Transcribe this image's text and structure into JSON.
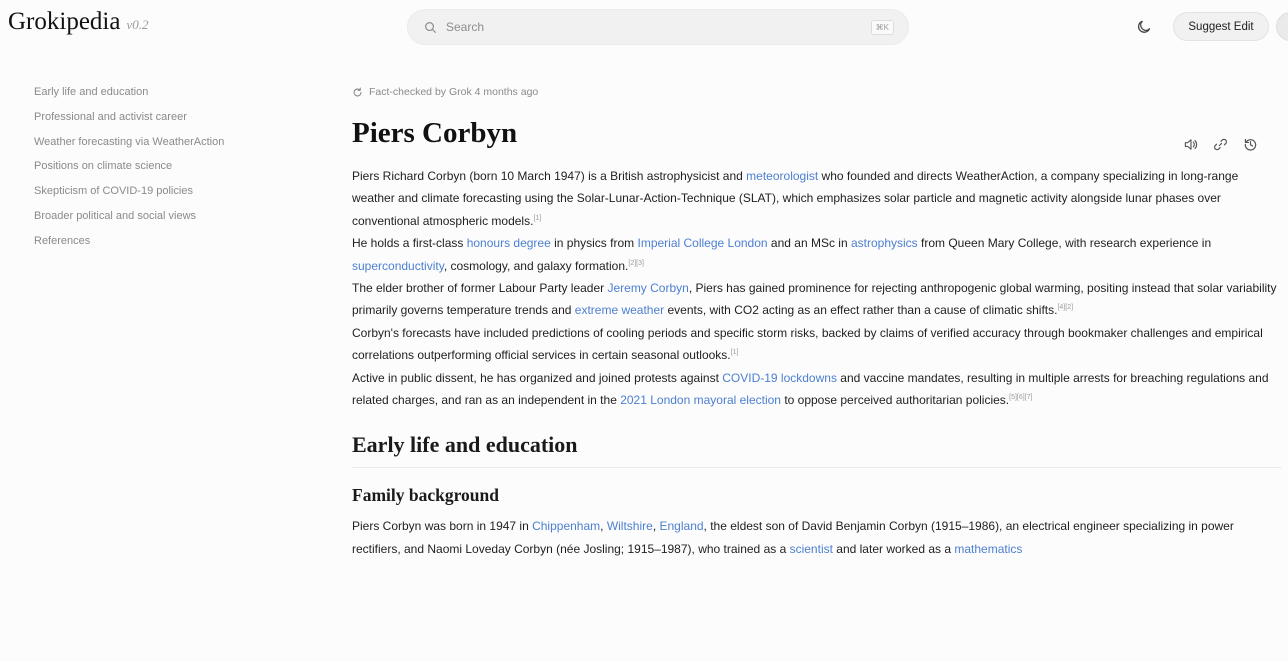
{
  "header": {
    "logo": "Grokipedia",
    "version": "v0.2",
    "search_placeholder": "Search",
    "search_shortcut": "⌘K",
    "suggest_edit": "Suggest Edit"
  },
  "icons": {
    "search": "search-icon",
    "theme": "moon-icon",
    "fact_check": "refresh-icon",
    "listen": "speaker-icon",
    "share": "link-icon",
    "history": "history-icon"
  },
  "colors": {
    "link": "#4c7fd1",
    "muted": "#8a8a8a"
  },
  "toc": [
    "Early life and education",
    "Professional and activist career",
    "Weather forecasting via WeatherAction",
    "Positions on climate science",
    "Skepticism of COVID-19 policies",
    "Broader political and social views",
    "References"
  ],
  "article": {
    "fact_check": "Fact-checked by Grok 4 months ago",
    "title": "Piers Corbyn",
    "p1": {
      "a": "Piers Richard Corbyn (born 10 March 1947) is a British astrophysicist and ",
      "link1": "meteorologist",
      "b": " who founded and directs WeatherAction, a company specializing in long-range weather and climate forecasting using the Solar-Lunar-Action-Technique (SLAT), which emphasizes solar particle and magnetic activity alongside lunar phases over conventional atmospheric models.",
      "ref": "[1]"
    },
    "p2": {
      "a": "He holds a first-class ",
      "link1": "honours degree",
      "b": " in physics from ",
      "link2": "Imperial College London",
      "c": " and an MSc in ",
      "link3": "astrophysics",
      "d": " from Queen Mary College, with research experience in ",
      "link4": "superconductivity",
      "e": ", cosmology, and galaxy formation.",
      "ref": "[2][3]"
    },
    "p3": {
      "a": "The elder brother of former Labour Party leader ",
      "link1": "Jeremy Corbyn",
      "b": ", Piers has gained prominence for rejecting anthropogenic global warming, positing instead that solar variability primarily governs temperature trends and ",
      "link2": "extreme weather",
      "c": " events, with CO2 acting as an effect rather than a cause of climatic shifts.",
      "ref": "[4][2]"
    },
    "p4": {
      "a": "Corbyn's forecasts have included predictions of cooling periods and specific storm risks, backed by claims of verified accuracy through bookmaker challenges and empirical correlations outperforming official services in certain seasonal outlooks.",
      "ref": "[1]"
    },
    "p5": {
      "a": "Active in public dissent, he has organized and joined protests against ",
      "link1": "COVID-19 lockdowns",
      "b": " and vaccine mandates, resulting in multiple arrests for breaching regulations and related charges, and ran as an independent in the ",
      "link2": "2021 London mayoral election",
      "c": " to oppose perceived authoritarian policies.",
      "ref": "[5][6][7]"
    },
    "h2": "Early life and education",
    "h3": "Family background",
    "p6": {
      "a": "Piers Corbyn was born in 1947 in ",
      "link1": "Chippenham",
      "b": ", ",
      "link2": "Wiltshire",
      "c": ", ",
      "link3": "England",
      "d": ", the eldest son of David Benjamin Corbyn (1915–1986), an electrical engineer specializing in power rectifiers, and Naomi Loveday Corbyn (née Josling; 1915–1987), who trained as a ",
      "link4": "scientist",
      "e": " and later worked as a ",
      "link5": "mathematics"
    }
  }
}
